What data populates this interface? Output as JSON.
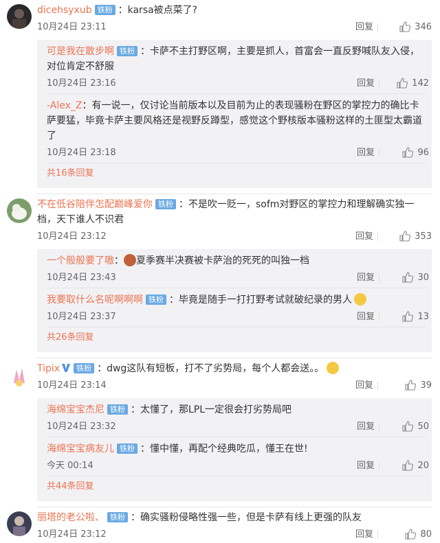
{
  "badge_label": "铁粉",
  "reply_label": "回复",
  "colors": {
    "name": "#eb7350",
    "badge": "#6aa9e2",
    "reply_bg": "#f2f2f5"
  },
  "comments": [
    {
      "user": "dicehsyxub",
      "text": "karsa被点菜了?",
      "time": "10月24日 23:11",
      "likes": "346",
      "replies": [
        {
          "user": "可是我在散步啊",
          "text": "卡萨不主打野区啊，主要是抓人，首富会一直反野喊队友入侵，对位肯定不舒服",
          "time": "10月24日 23:16",
          "likes": "142"
        },
        {
          "user": "-Alex_Z",
          "text": "有一说一，仅讨论当前版本以及目前为止的表现骚粉在野区的掌控力的确比卡萨要猛，毕竟卡萨主要风格还是视野反蹲型，感觉这个野核版本骚粉这样的土匪型太霸道了",
          "time": "10月24日 23:18",
          "likes": "96"
        }
      ],
      "more": "共16条回复"
    },
    {
      "user": "不在低谷陪伴怎配巅峰爱你",
      "text": "不是吹一贬一，sofm对野区的掌控力和理解确实独一档，天下谁人不识君",
      "time": "10月24日 23:12",
      "likes": "353",
      "replies": [
        {
          "user": "一个般般要了嗷",
          "text": "夏季赛半决赛被卡萨治的死死的叫独一档",
          "time": "10月24日 23:43",
          "likes": "30"
        },
        {
          "user": "我要取什么名呢啊啊啊",
          "text": "毕竟是随手一打打野考试就破纪录的男人",
          "time": "10月24日 23:37",
          "likes": "13"
        }
      ],
      "more": "共26条回复"
    },
    {
      "user": "Tipix",
      "text": "dwg这队有短板，打不了劣势局，每个人都会送。。",
      "time": "10月24日 23:14",
      "likes": "39",
      "replies": [
        {
          "user": "海绵宝宝杰尼",
          "text": "太懂了，那LPL一定很会打劣势局吧",
          "time": "10月24日 23:32",
          "likes": "50"
        },
        {
          "user": "海绵宝宝病友儿",
          "text": "懂中懂，再配个经典吃瓜，懂王在世!",
          "time": "今天 00:14",
          "likes": "20"
        }
      ],
      "more": "共44条回复"
    },
    {
      "user": "丽塔的老公啦、",
      "text": "确实骚粉侵略性强一些，但是卡萨有线上更强的队友",
      "time": "10月24日 23:12",
      "likes": "80",
      "replies": [],
      "more": ""
    }
  ]
}
